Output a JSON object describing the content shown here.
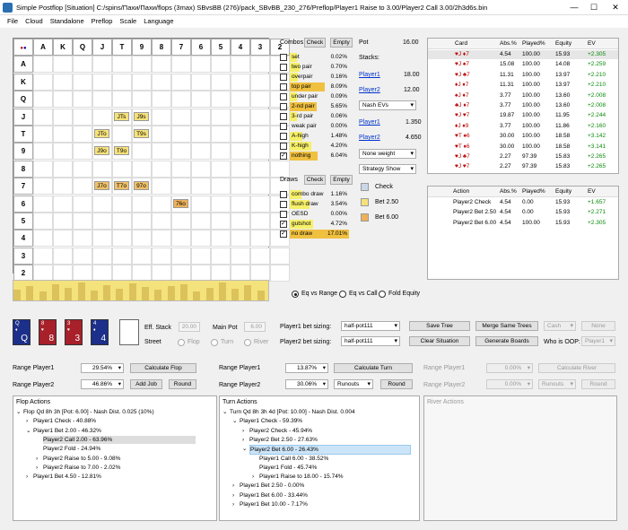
{
  "window": {
    "title": "Simple Postflop [Situation] C:/spins/Пахи/Пахи/flops (3max) SBvsBB (276)/pack_SBvBB_230_276/Preflop/Player1 Raise to 3.00/Player2 Call 3.00/2h3d6s.bin",
    "min": "—",
    "max": "☐",
    "close": "✕"
  },
  "menu": [
    "File",
    "Cloud",
    "Standalone",
    "Preflop",
    "Scale",
    "Language"
  ],
  "grid": {
    "cols": [
      "A",
      "K",
      "Q",
      "J",
      "T",
      "9",
      "8",
      "7",
      "6",
      "5",
      "4",
      "3",
      "2"
    ],
    "rows": [
      "A",
      "K",
      "Q",
      "J",
      "T",
      "9",
      "8",
      "7",
      "6",
      "5",
      "4",
      "3",
      "2"
    ],
    "cells": [
      {
        "label": "JTs",
        "r": 3,
        "c": 4,
        "color": "#f6e27a"
      },
      {
        "label": "J9s",
        "r": 3,
        "c": 5,
        "color": "#f6e27a"
      },
      {
        "label": "JTo",
        "r": 4,
        "c": 3,
        "color": "#f6e27a"
      },
      {
        "label": "T9s",
        "r": 4,
        "c": 5,
        "color": "#f6e27a"
      },
      {
        "label": "J9o",
        "r": 5,
        "c": 3,
        "color": "#f6e27a"
      },
      {
        "label": "T9o",
        "r": 5,
        "c": 4,
        "color": "#f6e27a"
      },
      {
        "label": "J7o",
        "r": 7,
        "c": 3,
        "color": "#eec06a"
      },
      {
        "label": "T7o",
        "r": 7,
        "c": 4,
        "color": "#eec06a"
      },
      {
        "label": "97o",
        "r": 7,
        "c": 5,
        "color": "#eec06a"
      },
      {
        "label": "76o",
        "r": 8,
        "c": 7,
        "color": "#eeb15a"
      }
    ]
  },
  "combos": {
    "title": "Combos",
    "check": "Check",
    "empty": "Empty",
    "items": [
      {
        "name": "set",
        "pct": "0.02%",
        "v": 0.02,
        "on": false
      },
      {
        "name": "two pair",
        "pct": "0.70%",
        "v": 0.7,
        "on": false
      },
      {
        "name": "overpair",
        "pct": "0.16%",
        "v": 0.16,
        "on": false
      },
      {
        "name": "top pair",
        "pct": "8.09%",
        "v": 8.09,
        "on": false
      },
      {
        "name": "under pair",
        "pct": "0.09%",
        "v": 0.09,
        "on": false
      },
      {
        "name": "2-nd pair",
        "pct": "5.65%",
        "v": 5.65,
        "on": false
      },
      {
        "name": "3-rd pair",
        "pct": "0.06%",
        "v": 0.06,
        "on": false
      },
      {
        "name": "weak pair",
        "pct": "0.00%",
        "v": 0,
        "on": false
      },
      {
        "name": "A-high",
        "pct": "1.48%",
        "v": 1.48,
        "on": false
      },
      {
        "name": "K-high",
        "pct": "4.20%",
        "v": 4.2,
        "on": false
      },
      {
        "name": "nothing",
        "pct": "6.04%",
        "v": 6.04,
        "on": true
      }
    ]
  },
  "draws": {
    "title": "Draws",
    "check": "Check",
    "empty": "Empty",
    "items": [
      {
        "name": "combo draw",
        "pct": "1.16%",
        "v": 1.16,
        "on": false
      },
      {
        "name": "flush draw",
        "pct": "3.54%",
        "v": 3.54,
        "on": false
      },
      {
        "name": "OESD",
        "pct": "0.00%",
        "v": 0,
        "on": false
      },
      {
        "name": "gutshot",
        "pct": "4.72%",
        "v": 4.72,
        "on": true
      },
      {
        "name": "no draw",
        "pct": "17.01%",
        "v": 17.01,
        "on": true
      }
    ]
  },
  "info": {
    "pot_label": "Pot",
    "pot": "16.00",
    "stacks_label": "Stacks:",
    "p1": "Player1",
    "p1_stack": "18.00",
    "p2": "Player2",
    "p2_stack": "12.00",
    "ev_mode": "Nash EVs",
    "p1_val": "1.350",
    "p2_val": "4.650",
    "weight": "None weight",
    "strategy": "Strategy Show"
  },
  "legend": [
    {
      "label": "Check",
      "color": "#c9d7e6"
    },
    {
      "label": "Bet 2.50",
      "color": "#f6e27a"
    },
    {
      "label": "Bet 6.00",
      "color": "#eeb15a"
    }
  ],
  "hands_table": {
    "headers": [
      "Card",
      "Abs.%",
      "Played%",
      "Equity",
      "EV"
    ],
    "rows": [
      [
        "♥J ♦7",
        "4.54",
        "100.00",
        "15.93",
        "+2.305"
      ],
      [
        "♥J ♠7",
        "15.08",
        "100.00",
        "14.08",
        "+2.259"
      ],
      [
        "♥J ♣7",
        "11.31",
        "100.00",
        "13.97",
        "+2.210"
      ],
      [
        "♦J ♦7",
        "11.31",
        "100.00",
        "13.97",
        "+2.210"
      ],
      [
        "♠J ♦7",
        "3.77",
        "100.00",
        "13.60",
        "+2.008"
      ],
      [
        "♣J ♦7",
        "3.77",
        "100.00",
        "13.60",
        "+2.008"
      ],
      [
        "♥J ♥7",
        "19.87",
        "100.00",
        "11.95",
        "+2.244"
      ],
      [
        "♦J ♦9",
        "3.77",
        "100.00",
        "11.86",
        "+2.160"
      ],
      [
        "♥T ♠6",
        "30.00",
        "100.00",
        "18.58",
        "+3.142"
      ],
      [
        "♥T ♦6",
        "30.00",
        "100.00",
        "18.58",
        "+3.141"
      ],
      [
        "♥J ♣7",
        "2.27",
        "97.39",
        "15.83",
        "+2.265"
      ],
      [
        "♥J ♥7",
        "2.27",
        "97.39",
        "15.83",
        "+2.265"
      ]
    ]
  },
  "action_table": {
    "headers": [
      "Action",
      "Abs.%",
      "Played%",
      "Equity",
      "EV"
    ],
    "rows": [
      [
        "Player2 Check",
        "4.54",
        "0.00",
        "15.93",
        "+1.657"
      ],
      [
        "Player2 Bet 2.50",
        "4.54",
        "0.00",
        "15.93",
        "+2.271"
      ],
      [
        "Player2 Bet 6.00",
        "4.54",
        "100.00",
        "15.93",
        "+2.305"
      ]
    ]
  },
  "eq_mode": {
    "options": [
      "Eq vs Range",
      "Eq vs Call",
      "Fold Equity"
    ],
    "selected": 0
  },
  "board": [
    {
      "rank": "Q",
      "suit": "♦",
      "color": "#1c2f8a"
    },
    {
      "rank": "8",
      "suit": "♥",
      "color": "#a8202a"
    },
    {
      "rank": "3",
      "suit": "♥",
      "color": "#a8202a"
    },
    {
      "rank": "4",
      "suit": "♦",
      "color": "#1c2f8a"
    }
  ],
  "controls": {
    "eff_stack_label": "Eff. Stack",
    "eff_stack": "20.00",
    "main_pot_label": "Main Pot",
    "main_pot": "6.00",
    "street_label": "Street",
    "streets": [
      "Flop",
      "Turn",
      "River"
    ],
    "p1_sizing_label": "Player1 bet sizing:",
    "p1_sizing": "half-pot111",
    "p2_sizing_label": "Player2 bet sizing:",
    "p2_sizing": "half-pot111",
    "save_tree": "Save Tree",
    "merge": "Merge Same Trees",
    "cash": "Cash",
    "none": "None",
    "clear": "Clear Situation",
    "gen": "Generate Boards",
    "oop_label": "Who is OOP:",
    "oop": "Player1"
  },
  "ranges": {
    "rp1": "Range Player1",
    "rp2": "Range Player2",
    "flop_p1": "29.54%",
    "flop_p2": "46.86%",
    "calc_flop": "Calculate Flop",
    "add_job": "Add Job",
    "round": "Round",
    "turn_p1": "13.87%",
    "turn_p2": "30.06%",
    "calc_turn": "Calculate Turn",
    "runouts": "Runouts",
    "river_p1": "0.00%",
    "river_p2": "0.00%",
    "calc_river": "Calculate River"
  },
  "flop_actions": {
    "title": "Flop Actions",
    "nodes": [
      {
        "t": "Flop Qd 8h 3h [Pot: 6.00] - Nash Dist. 0.025 (10%)",
        "l": 0,
        "e": "⌄"
      },
      {
        "t": "Player1 Check - 40.88%",
        "l": 1,
        "e": "›"
      },
      {
        "t": "Player1 Bet 2.00 - 46.32%",
        "l": 1,
        "e": "⌄"
      },
      {
        "t": "Player2 Call 2.00 - 63.96%",
        "l": 2,
        "e": "",
        "hl": true
      },
      {
        "t": "Player2 Fold - 24.94%",
        "l": 2,
        "e": ""
      },
      {
        "t": "Player2 Raise to 5.00 - 9.08%",
        "l": 2,
        "e": "›"
      },
      {
        "t": "Player2 Raise to 7.00 - 2.02%",
        "l": 2,
        "e": "›"
      },
      {
        "t": "Player1 Bet 4.50 - 12.81%",
        "l": 1,
        "e": "›"
      }
    ]
  },
  "turn_actions": {
    "title": "Turn Actions",
    "nodes": [
      {
        "t": "Turn Qd 8h 3h 4d [Pot: 10.00] - Nash Dist. 0.004",
        "l": 0,
        "e": "⌄"
      },
      {
        "t": "Player1 Check - 59.39%",
        "l": 1,
        "e": "⌄"
      },
      {
        "t": "Player2 Check - 45.94%",
        "l": 2,
        "e": "›"
      },
      {
        "t": "Player2 Bet 2.50 - 27.63%",
        "l": 2,
        "e": "›"
      },
      {
        "t": "Player2 Bet 6.00 - 26.43%",
        "l": 2,
        "e": "⌄",
        "hlb": true
      },
      {
        "t": "Player1 Call 6.00 - 38.52%",
        "l": 3,
        "e": ""
      },
      {
        "t": "Player1 Fold - 45.74%",
        "l": 3,
        "e": ""
      },
      {
        "t": "Player1 Raise to 18.00 - 15.74%",
        "l": 3,
        "e": "›"
      },
      {
        "t": "Player1 Bet 2.50 - 0.00%",
        "l": 1,
        "e": "›"
      },
      {
        "t": "Player1 Bet 6.00 - 33.44%",
        "l": 1,
        "e": "›"
      },
      {
        "t": "Player1 Bet 10.00 - 7.17%",
        "l": 1,
        "e": "›"
      }
    ]
  },
  "river_actions": {
    "title": "River Actions"
  }
}
